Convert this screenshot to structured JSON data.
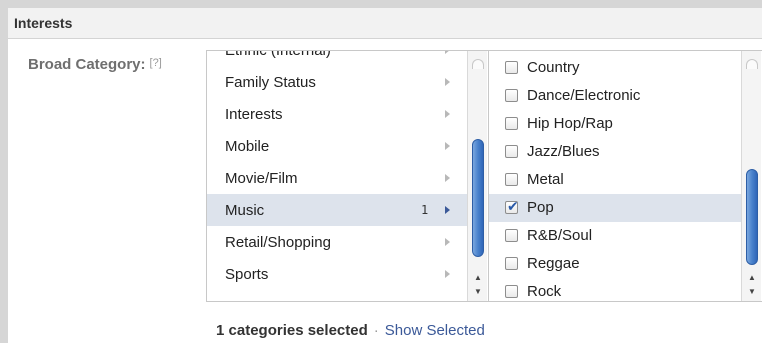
{
  "section": {
    "title": "Interests"
  },
  "broad_category": {
    "label": "Broad Category:",
    "help": "[?]"
  },
  "categories": [
    {
      "label": "Ethnic (Internal)"
    },
    {
      "label": "Family Status"
    },
    {
      "label": "Interests"
    },
    {
      "label": "Mobile"
    },
    {
      "label": "Movie/Film"
    },
    {
      "label": "Music",
      "count": "1",
      "selected": true
    },
    {
      "label": "Retail/Shopping"
    },
    {
      "label": "Sports"
    }
  ],
  "options": [
    {
      "label": "Country",
      "checked": false
    },
    {
      "label": "Dance/Electronic",
      "checked": false
    },
    {
      "label": "Hip Hop/Rap",
      "checked": false
    },
    {
      "label": "Jazz/Blues",
      "checked": false
    },
    {
      "label": "Metal",
      "checked": false
    },
    {
      "label": "Pop",
      "checked": true
    },
    {
      "label": "R&B/Soul",
      "checked": false
    },
    {
      "label": "Reggae",
      "checked": false
    },
    {
      "label": "Rock",
      "checked": false
    }
  ],
  "footer": {
    "selected_text": "1 categories selected",
    "separator": "·",
    "show_selected": "Show Selected"
  },
  "colors": {
    "selected_row": "#dde3ec",
    "link": "#3b5998",
    "scroll_thumb": "#4a82cc"
  }
}
